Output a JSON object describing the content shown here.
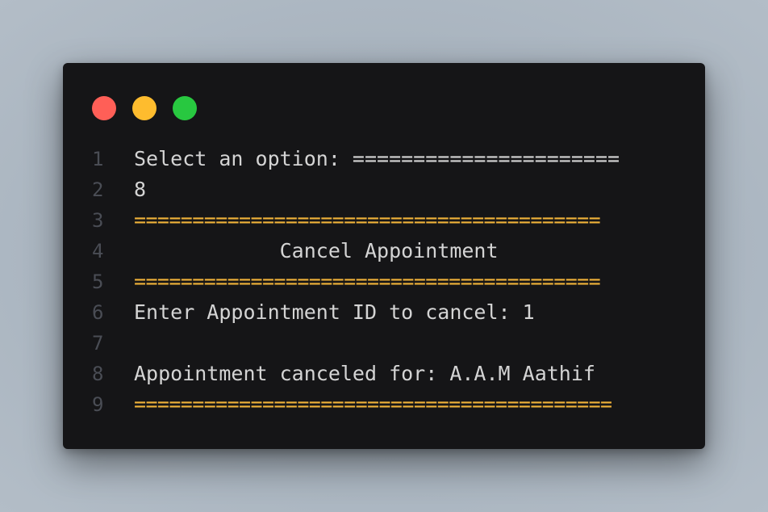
{
  "window": {
    "controls": [
      {
        "name": "close",
        "color": "#ff5f57"
      },
      {
        "name": "minimize",
        "color": "#febc2e"
      },
      {
        "name": "maximize",
        "color": "#28c840"
      }
    ]
  },
  "colors": {
    "background": "#151517",
    "text": "#d4d4d4",
    "line_number": "#4a4d55",
    "accent": "#f0b23a"
  },
  "lines": [
    {
      "number": "1",
      "text": "Select an option: ======================",
      "accent": false
    },
    {
      "number": "2",
      "text": "8",
      "accent": false
    },
    {
      "number": "3",
      "text": "========================================",
      "accent": true
    },
    {
      "number": "4",
      "text": "            Cancel Appointment",
      "accent": false
    },
    {
      "number": "5",
      "text": "========================================",
      "accent": true
    },
    {
      "number": "6",
      "text": "Enter Appointment ID to cancel: 1",
      "accent": false
    },
    {
      "number": "7",
      "text": "",
      "accent": false
    },
    {
      "number": "8",
      "text": "Appointment canceled for: A.A.M Aathif",
      "accent": false
    },
    {
      "number": "9",
      "text": "=========================================",
      "accent": true
    }
  ]
}
